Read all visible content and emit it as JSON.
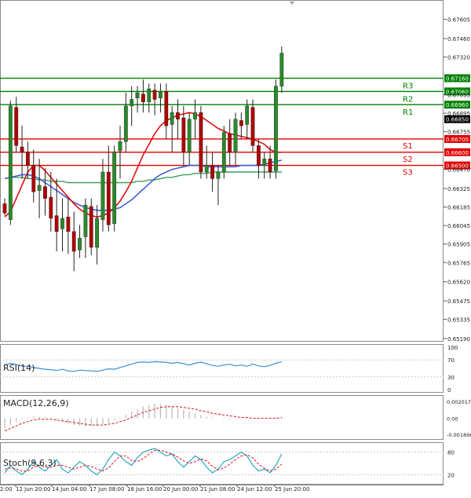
{
  "chart_data": {
    "type": "candlestick",
    "symbol": "",
    "timeframe": "",
    "x_labels": [
      "12 Jun 20:00",
      "14 Jun 04:00",
      "17 Jun 08:00",
      "18 Jun 16:00",
      "20 Jun 00:00",
      "21 Jun 08:00",
      "24 Jun 12:00",
      "25 Jun 20:00"
    ],
    "x_label_left_partial": "2:00",
    "price_ticks": [
      "0.67605",
      "0.67460",
      "0.67320",
      "0.67035",
      "0.66895",
      "0.66755",
      "0.66470",
      "0.66325",
      "0.66185",
      "0.66045",
      "0.65905",
      "0.65765",
      "0.65620",
      "0.65475",
      "0.65335",
      "0.65190"
    ],
    "price_range": [
      0.6519,
      0.6774
    ],
    "current_price": "0.66850",
    "levels": [
      {
        "name": "R3",
        "value": 0.6716,
        "label": "0.67160",
        "color": "#008000"
      },
      {
        "name": "R2",
        "value": 0.6706,
        "label": "0.67060",
        "color": "#008000"
      },
      {
        "name": "R1",
        "value": 0.6696,
        "label": "0.66960",
        "color": "#008000"
      },
      {
        "name": "S1",
        "value": 0.667,
        "label": "0.66700",
        "color": "#e00000"
      },
      {
        "name": "S2",
        "value": 0.666,
        "label": "0.66600",
        "color": "#e00000"
      },
      {
        "name": "S3",
        "value": 0.665,
        "label": "0.66500",
        "color": "#e00000"
      }
    ],
    "candles_ohlc": [
      [
        0.6621,
        0.6625,
        0.6612,
        0.6614
      ],
      [
        0.6609,
        0.6699,
        0.6605,
        0.6695
      ],
      [
        0.6694,
        0.6702,
        0.666,
        0.6665
      ],
      [
        0.6664,
        0.668,
        0.664,
        0.666
      ],
      [
        0.666,
        0.6668,
        0.664,
        0.665
      ],
      [
        0.665,
        0.6662,
        0.6622,
        0.663
      ],
      [
        0.6631,
        0.6655,
        0.661,
        0.6635
      ],
      [
        0.6634,
        0.6648,
        0.6612,
        0.6625
      ],
      [
        0.6626,
        0.6645,
        0.66,
        0.661
      ],
      [
        0.6612,
        0.664,
        0.6585,
        0.66
      ],
      [
        0.6602,
        0.6625,
        0.6585,
        0.661
      ],
      [
        0.6611,
        0.6625,
        0.6583,
        0.66
      ],
      [
        0.66,
        0.6615,
        0.657,
        0.6585
      ],
      [
        0.6586,
        0.6605,
        0.658,
        0.6595
      ],
      [
        0.6596,
        0.6625,
        0.658,
        0.662
      ],
      [
        0.6619,
        0.6625,
        0.6582,
        0.6588
      ],
      [
        0.6588,
        0.662,
        0.6575,
        0.661
      ],
      [
        0.6609,
        0.6655,
        0.66,
        0.6645
      ],
      [
        0.6645,
        0.6665,
        0.66,
        0.6605
      ],
      [
        0.6606,
        0.6665,
        0.66,
        0.666
      ],
      [
        0.6661,
        0.668,
        0.664,
        0.6668
      ],
      [
        0.6668,
        0.6705,
        0.666,
        0.6695
      ],
      [
        0.6695,
        0.671,
        0.668,
        0.67
      ],
      [
        0.6701,
        0.671,
        0.669,
        0.6705
      ],
      [
        0.6704,
        0.6715,
        0.669,
        0.6698
      ],
      [
        0.6698,
        0.6712,
        0.669,
        0.6708
      ],
      [
        0.6707,
        0.6712,
        0.6688,
        0.67
      ],
      [
        0.6701,
        0.6712,
        0.669,
        0.6706
      ],
      [
        0.6706,
        0.6712,
        0.667,
        0.668
      ],
      [
        0.6681,
        0.6695,
        0.666,
        0.669
      ],
      [
        0.669,
        0.67,
        0.667,
        0.6685
      ],
      [
        0.6686,
        0.6695,
        0.665,
        0.666
      ],
      [
        0.666,
        0.669,
        0.665,
        0.6685
      ],
      [
        0.6685,
        0.67,
        0.667,
        0.669
      ],
      [
        0.669,
        0.6695,
        0.664,
        0.6645
      ],
      [
        0.6645,
        0.6665,
        0.664,
        0.665
      ],
      [
        0.665,
        0.666,
        0.663,
        0.664
      ],
      [
        0.664,
        0.665,
        0.662,
        0.6645
      ],
      [
        0.6645,
        0.668,
        0.664,
        0.6675
      ],
      [
        0.6674,
        0.6685,
        0.665,
        0.666
      ],
      [
        0.666,
        0.669,
        0.665,
        0.6685
      ],
      [
        0.6684,
        0.669,
        0.667,
        0.668
      ],
      [
        0.6681,
        0.67,
        0.667,
        0.6695
      ],
      [
        0.6694,
        0.67,
        0.666,
        0.6665
      ],
      [
        0.6665,
        0.667,
        0.664,
        0.665
      ],
      [
        0.665,
        0.666,
        0.664,
        0.6655
      ],
      [
        0.6655,
        0.6665,
        0.664,
        0.6645
      ],
      [
        0.6646,
        0.6715,
        0.664,
        0.671
      ],
      [
        0.671,
        0.674,
        0.6705,
        0.6735
      ]
    ],
    "ma_red": [
      0.6611,
      0.6615,
      0.6625,
      0.6635,
      0.6645,
      0.665,
      0.665,
      0.6646,
      0.6641,
      0.6636,
      0.6631,
      0.6626,
      0.6621,
      0.6617,
      0.6614,
      0.6612,
      0.6611,
      0.6612,
      0.6614,
      0.6618,
      0.6623,
      0.663,
      0.6638,
      0.6648,
      0.6658,
      0.6666,
      0.6674,
      0.668,
      0.6684,
      0.6686,
      0.6688,
      0.6689,
      0.669,
      0.6689,
      0.6687,
      0.6684,
      0.6681,
      0.6678,
      0.6676,
      0.6674,
      0.6673,
      0.6672,
      0.6671,
      0.667,
      0.6668,
      0.6666,
      0.6662,
      0.666,
      0.666
    ],
    "ma_blue": [
      0.664,
      0.6641,
      0.6642,
      0.6643,
      0.6643,
      0.6642,
      0.664,
      0.6637,
      0.6634,
      0.6631,
      0.6628,
      0.6625,
      0.6622,
      0.662,
      0.6618,
      0.6617,
      0.6616,
      0.6616,
      0.6616,
      0.6617,
      0.6618,
      0.6621,
      0.6624,
      0.6628,
      0.6632,
      0.6636,
      0.664,
      0.6643,
      0.6645,
      0.6647,
      0.6648,
      0.6649,
      0.665,
      0.665,
      0.665,
      0.6649,
      0.6649,
      0.6649,
      0.6649,
      0.6649,
      0.6649,
      0.665,
      0.665,
      0.665,
      0.665,
      0.6651,
      0.6652,
      0.6653,
      0.6654
    ],
    "ma_green": [
      0.664,
      0.6641,
      0.6641,
      0.6641,
      0.664,
      0.664,
      0.6639,
      0.6639,
      0.6638,
      0.6638,
      0.6638,
      0.6637,
      0.6637,
      0.6637,
      0.6637,
      0.6637,
      0.6637,
      0.6637,
      0.6637,
      0.6637,
      0.6637,
      0.6637,
      0.6637,
      0.6638,
      0.6638,
      0.6639,
      0.6639,
      0.664,
      0.6641,
      0.6641,
      0.6642,
      0.6643,
      0.6643,
      0.6644,
      0.6644,
      0.6644,
      0.6645,
      0.6645,
      0.6645,
      0.6645,
      0.6645,
      0.6645,
      0.6645,
      0.6645,
      0.6645,
      0.6645,
      0.6645,
      0.6645,
      0.6645
    ],
    "rsi": {
      "label": "RSI(14)",
      "ticks": [
        "100",
        "70",
        "30",
        "0"
      ],
      "values": [
        58,
        62,
        59,
        55,
        55,
        52,
        50,
        48,
        47,
        45,
        48,
        44,
        43,
        46,
        45,
        44,
        43,
        46,
        49,
        48,
        52,
        56,
        60,
        64,
        65,
        64,
        66,
        65,
        64,
        62,
        64,
        61,
        58,
        62,
        65,
        61,
        57,
        55,
        58,
        60,
        56,
        58,
        55,
        60,
        56,
        54,
        57,
        62,
        66
      ]
    },
    "macd": {
      "label": "MACD(12,26,9)",
      "ticks": [
        "0.002017",
        "0.00",
        "-0.001896"
      ],
      "range": [
        -0.0022,
        0.0024
      ],
      "histogram": [
        -0.0012,
        -0.0008,
        -0.0004,
        -0.0001,
        0.0001,
        0.0002,
        0.0002,
        0.0001,
        0.0,
        -0.0002,
        -0.0004,
        -0.0006,
        -0.0008,
        -0.0009,
        -0.001,
        -0.001,
        -0.0009,
        -0.0007,
        -0.0005,
        -0.0002,
        0.0001,
        0.0004,
        0.0008,
        0.0011,
        0.0014,
        0.0016,
        0.0017,
        0.0017,
        0.0016,
        0.0014,
        0.0012,
        0.001,
        0.0008,
        0.0006,
        0.0004,
        0.0002,
        0.0001,
        0.0,
        -0.0001,
        -0.0001,
        -0.0001,
        0.0,
        0.0,
        0.0,
        0.0,
        0.0,
        0.0,
        0.0001,
        0.0002
      ],
      "signal": [
        -0.0015,
        -0.0012,
        -0.0009,
        -0.0006,
        -0.0004,
        -0.0002,
        -0.0001,
        -0.0001,
        -0.0001,
        -0.0002,
        -0.0003,
        -0.0004,
        -0.0005,
        -0.0006,
        -0.0007,
        -0.0008,
        -0.0008,
        -0.0008,
        -0.0007,
        -0.0006,
        -0.0004,
        -0.0002,
        0.0001,
        0.0004,
        0.0007,
        0.0009,
        0.0011,
        0.0013,
        0.0014,
        0.0014,
        0.0014,
        0.0013,
        0.0012,
        0.0011,
        0.0009,
        0.0008,
        0.0006,
        0.0005,
        0.0004,
        0.0003,
        0.0002,
        0.0001,
        0.0001,
        0.0,
        0.0,
        0.0,
        0.0,
        0.0,
        0.0001
      ]
    },
    "stoch": {
      "label": "Stoch(9,6,3)",
      "ticks": [
        "80",
        "20"
      ],
      "k": [
        25,
        45,
        30,
        20,
        35,
        55,
        40,
        30,
        45,
        60,
        35,
        25,
        40,
        55,
        45,
        30,
        20,
        35,
        60,
        80,
        70,
        55,
        45,
        65,
        80,
        85,
        90,
        80,
        70,
        75,
        55,
        40,
        55,
        70,
        60,
        40,
        25,
        35,
        55,
        60,
        70,
        80,
        70,
        45,
        30,
        35,
        25,
        45,
        75
      ],
      "d": [
        35,
        38,
        35,
        30,
        30,
        40,
        45,
        40,
        40,
        45,
        45,
        40,
        35,
        40,
        45,
        42,
        35,
        30,
        38,
        55,
        70,
        70,
        58,
        55,
        63,
        75,
        85,
        85,
        80,
        75,
        67,
        57,
        50,
        55,
        62,
        57,
        42,
        33,
        38,
        48,
        60,
        70,
        73,
        65,
        48,
        37,
        30,
        35,
        48
      ]
    }
  }
}
